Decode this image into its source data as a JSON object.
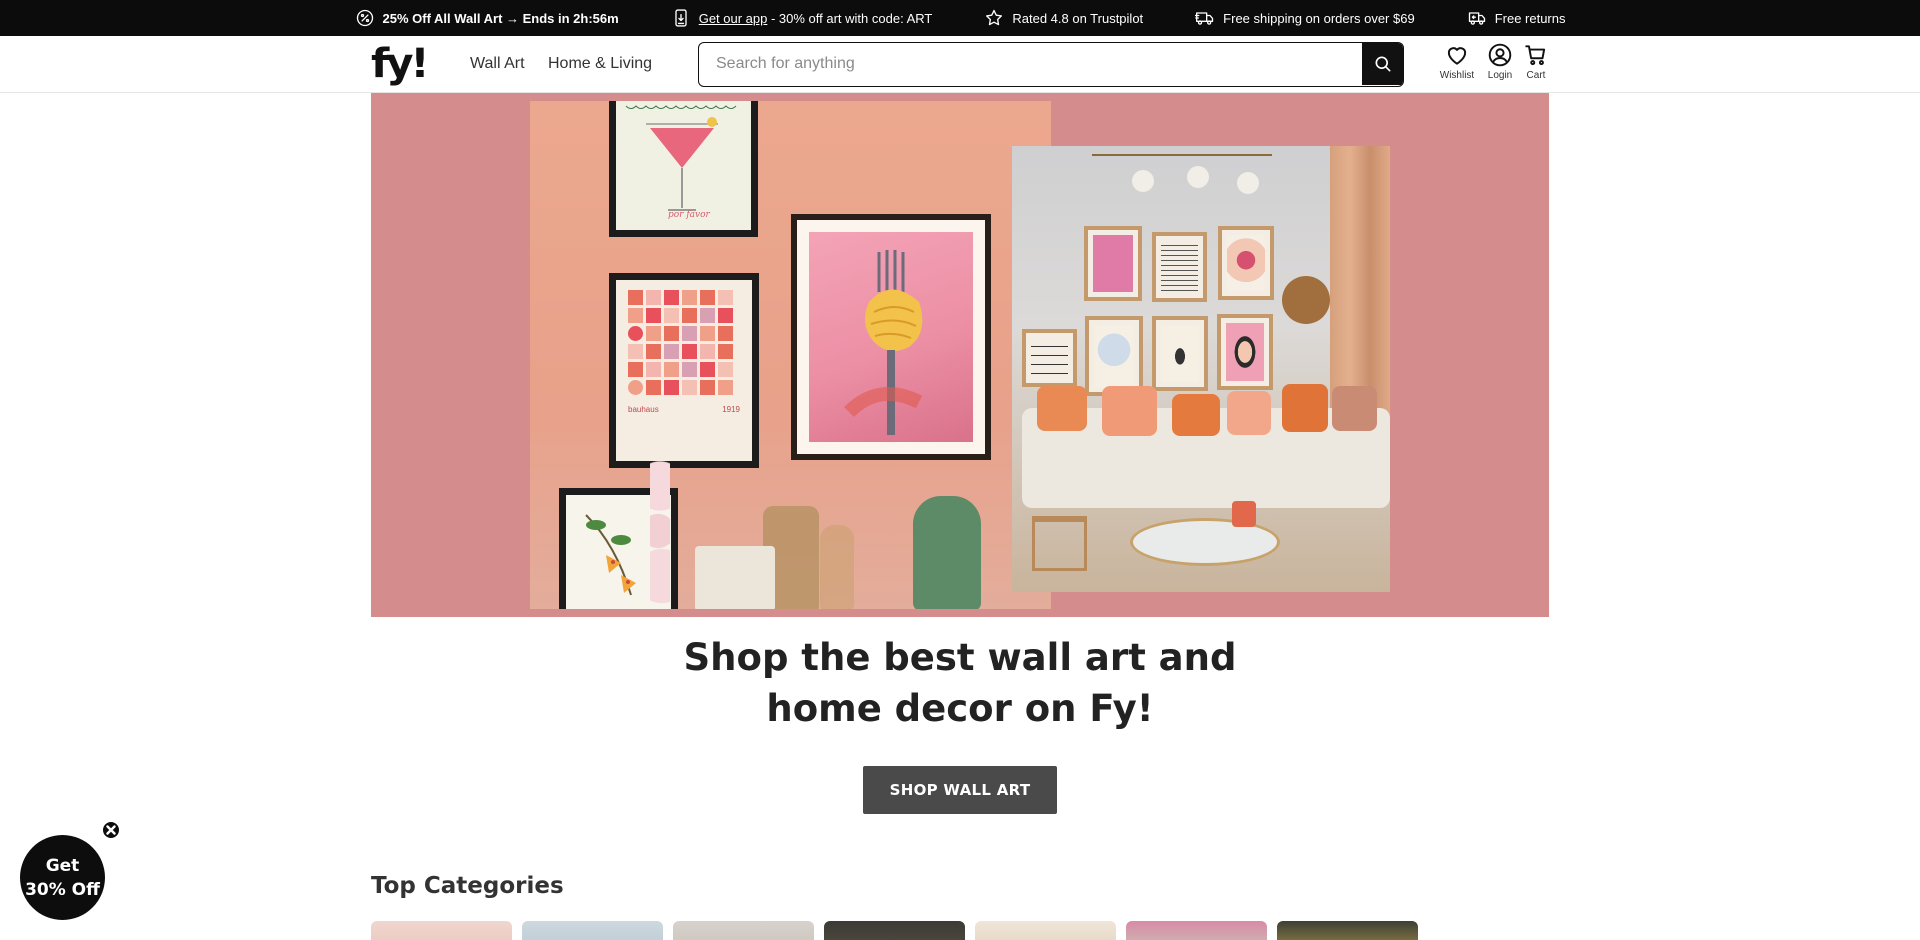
{
  "promo_bar": {
    "items": [
      {
        "icon": "discount-badge-icon",
        "bold_text": "25% Off All Wall Art → Ends in 2h:56m"
      },
      {
        "icon": "phone-download-icon",
        "link_text": "Get our app",
        "text": " - 30% off art with code: ART"
      },
      {
        "icon": "star-icon",
        "text": "Rated 4.8 on Trustpilot"
      },
      {
        "icon": "truck-icon",
        "text": "Free shipping on orders over $69"
      },
      {
        "icon": "return-truck-icon",
        "text": "Free returns"
      }
    ]
  },
  "header": {
    "logo_text": "fy!",
    "nav": [
      "Wall Art",
      "Home & Living"
    ],
    "search_placeholder": "Search for anything",
    "icons": [
      {
        "name": "heart-icon",
        "label": "Wishlist"
      },
      {
        "name": "user-icon",
        "label": "Login"
      },
      {
        "name": "cart-icon",
        "label": "Cart"
      }
    ]
  },
  "hero": {
    "poster_texts": {
      "cocktail_caption": "por favor",
      "bauhaus_label": "bauhaus",
      "bauhaus_year": "1919"
    },
    "colors": {
      "background": "#d48c8c",
      "wall": "#eca88f"
    }
  },
  "main": {
    "title_line1": "Shop the best wall art and",
    "title_line2": "home decor on Fy!",
    "cta_label": "SHOP WALL ART",
    "top_categories_title": "Top Categories"
  },
  "popup": {
    "line1": "Get",
    "line2": "30% Off"
  }
}
